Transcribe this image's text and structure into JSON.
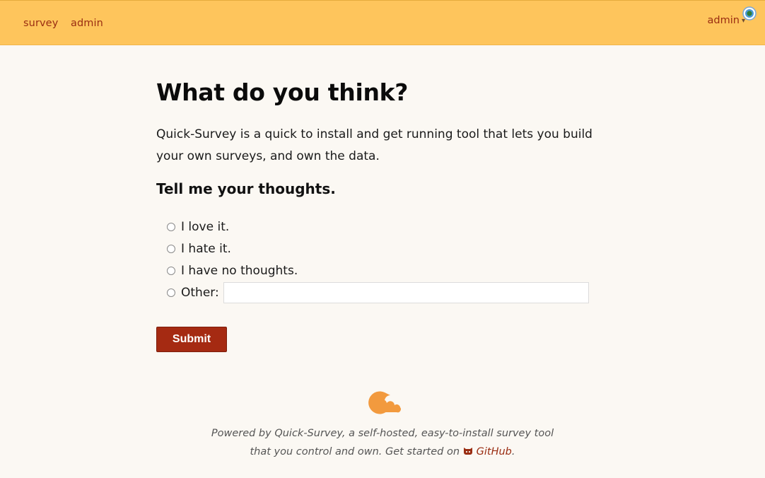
{
  "nav": {
    "links": [
      {
        "label": "survey"
      },
      {
        "label": "admin"
      }
    ],
    "user_menu": {
      "label": "admin",
      "caret_icon": "chevron-down-icon"
    },
    "status_icon": "status-dot-icon"
  },
  "main": {
    "title": "What do you think?",
    "intro": "Quick-Survey is a quick to install and get running tool that lets you build your own surveys, and own the data.",
    "question": "Tell me your thoughts.",
    "options": [
      {
        "label": "I love it.",
        "selected": false
      },
      {
        "label": "I hate it.",
        "selected": false
      },
      {
        "label": "I have no thoughts.",
        "selected": false
      },
      {
        "label": "Other:",
        "selected": false
      }
    ],
    "other_value": "",
    "other_placeholder": "",
    "submit_label": "Submit"
  },
  "footer": {
    "logo_icon": "quick-survey-logo-icon",
    "line1": "Powered by Quick-Survey, a self-hosted, easy-to-install survey tool",
    "line2_prefix": "that you control and own. Get started on",
    "github_icon": "github-octocat-icon",
    "github_label": "GitHub",
    "line2_suffix": "."
  },
  "colors": {
    "topbar": "#fec55c",
    "accent": "#9a2d12",
    "button": "#a52a12",
    "background": "#fbf8f3",
    "logo": "#f29a3e"
  }
}
